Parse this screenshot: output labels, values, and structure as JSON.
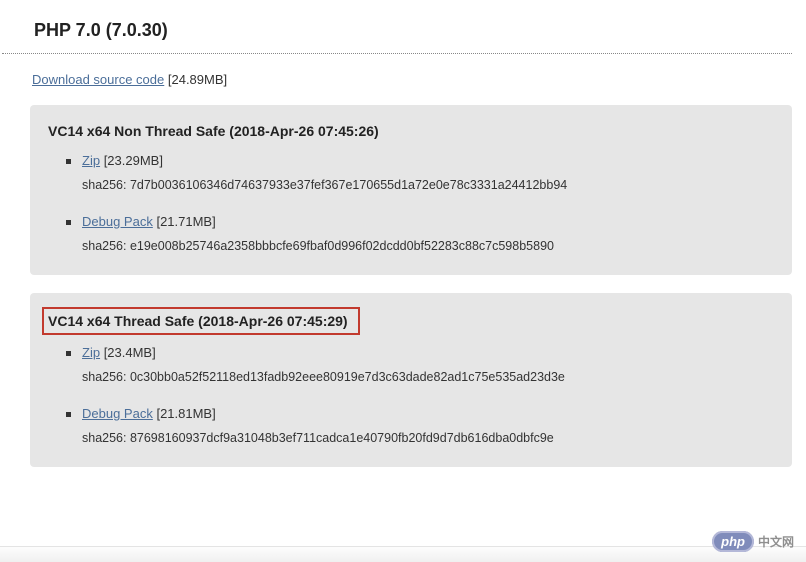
{
  "title": "PHP 7.0 (7.0.30)",
  "source": {
    "label": "Download source code",
    "size": "[24.89MB]"
  },
  "panels": [
    {
      "title": "VC14 x64 Non Thread Safe (2018-Apr-26 07:45:26)",
      "highlight": false,
      "items": [
        {
          "link": "Zip",
          "size": "[23.29MB]",
          "sha": "sha256: 7d7b0036106346d74637933e37fef367e170655d1a72e0e78c3331a24412bb94"
        },
        {
          "link": "Debug Pack",
          "size": "[21.71MB]",
          "sha": "sha256: e19e008b25746a2358bbbcfe69fbaf0d996f02dcdd0bf52283c88c7c598b5890"
        }
      ]
    },
    {
      "title": "VC14 x64 Thread Safe (2018-Apr-26 07:45:29)",
      "highlight": true,
      "items": [
        {
          "link": "Zip",
          "size": "[23.4MB]",
          "sha": "sha256: 0c30bb0a52f52118ed13fadb92eee80919e7d3c63dade82ad1c75e535ad23d3e"
        },
        {
          "link": "Debug Pack",
          "size": "[21.81MB]",
          "sha": "sha256: 87698160937dcf9a31048b3ef711cadca1e40790fb20fd9d7db616dba0dbfc9e"
        }
      ]
    }
  ],
  "watermark": {
    "pill": "php",
    "text": "中文网"
  }
}
